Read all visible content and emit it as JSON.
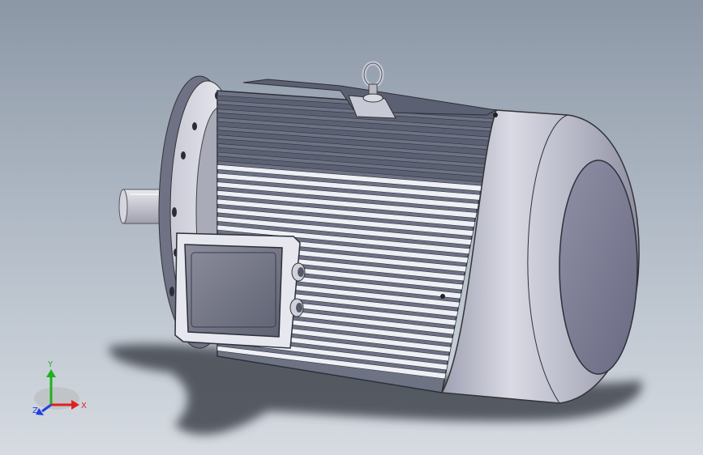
{
  "viewport": {
    "background_top": "#8c97a6",
    "background_bottom": "#d6dbe1"
  },
  "model": {
    "icon": "electric-motor",
    "body_color": "#7d8394",
    "fin_color": "#ececf2",
    "fan_cover_color": "#b8bac8",
    "shadow_color": "#3a3f47"
  },
  "triad": {
    "x_label": "X",
    "y_label": "Y",
    "z_label": "Z",
    "x_color": "#e02020",
    "y_color": "#20b020",
    "z_color": "#2040e0"
  }
}
